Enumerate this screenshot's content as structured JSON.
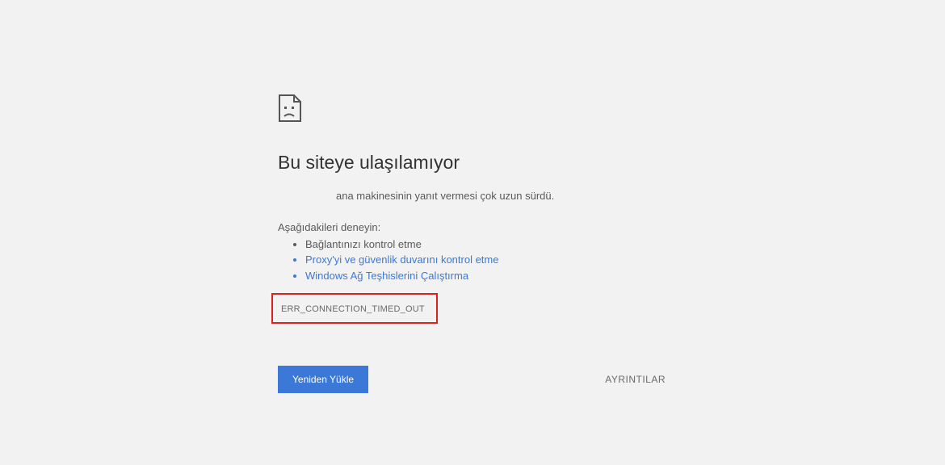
{
  "error": {
    "title": "Bu siteye ulaşılamıyor",
    "subtitle": "ana makinesinin yanıt vermesi çok uzun sürdü.",
    "try_label": "Aşağıdakileri deneyin:",
    "suggestions": {
      "s0": "Bağlantınızı kontrol etme",
      "s1": "Proxy'yi ve güvenlik duvarını kontrol etme",
      "s2": "Windows Ağ Teşhislerini Çalıştırma"
    },
    "code": "ERR_CONNECTION_TIMED_OUT"
  },
  "buttons": {
    "reload": "Yeniden Yükle",
    "details": "AYRINTILAR"
  },
  "icon": "sad-page-icon",
  "colors": {
    "link": "#3b78d8",
    "highlight_border": "#e02020",
    "button_bg": "#3b78d8"
  }
}
